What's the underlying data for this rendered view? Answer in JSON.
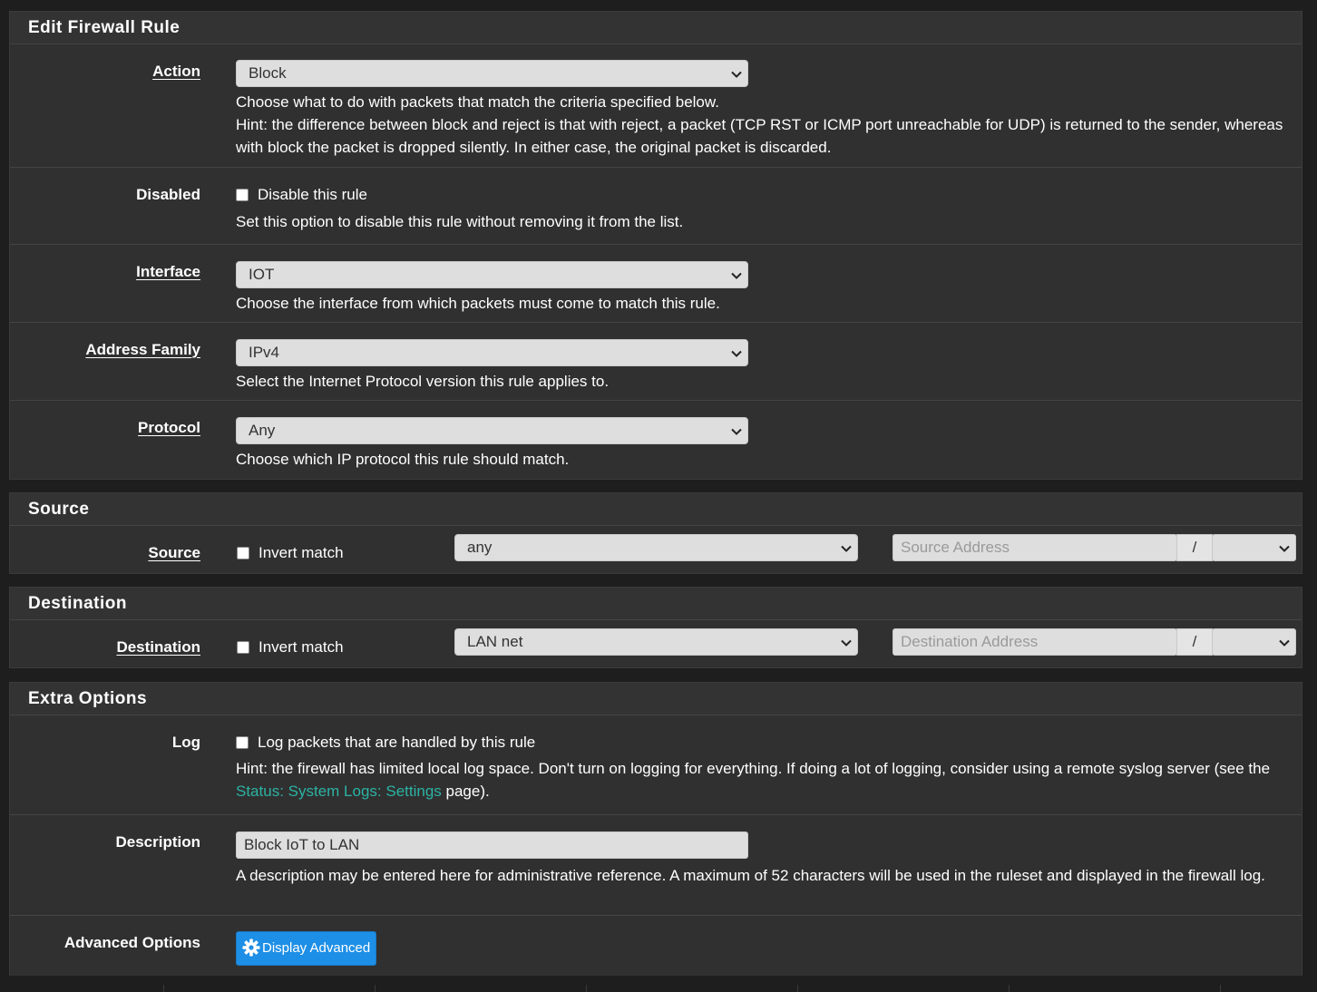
{
  "rule": {
    "heading": "Edit Firewall Rule",
    "action": {
      "label": "Action",
      "value": "Block",
      "help1": "Choose what to do with packets that match the criteria specified below.",
      "help2": "Hint: the difference between block and reject is that with reject, a packet (TCP RST or ICMP port unreachable for UDP) is returned to the sender, whereas with block the packet is dropped silently. In either case, the original packet is discarded."
    },
    "disabled": {
      "label": "Disabled",
      "checkbox_label": "Disable this rule",
      "checked": false,
      "help": "Set this option to disable this rule without removing it from the list."
    },
    "interface": {
      "label": "Interface",
      "value": "IOT",
      "help": "Choose the interface from which packets must come to match this rule."
    },
    "address_family": {
      "label": "Address Family",
      "value": "IPv4",
      "help": "Select the Internet Protocol version this rule applies to."
    },
    "protocol": {
      "label": "Protocol",
      "value": "Any",
      "help": "Choose which IP protocol this rule should match."
    }
  },
  "source": {
    "heading": "Source",
    "label": "Source",
    "invert_label": "Invert match",
    "invert_checked": false,
    "type_value": "any",
    "address_placeholder": "Source Address",
    "slash": "/"
  },
  "destination": {
    "heading": "Destination",
    "label": "Destination",
    "invert_label": "Invert match",
    "invert_checked": false,
    "type_value": "LAN net",
    "address_placeholder": "Destination Address",
    "slash": "/"
  },
  "extra": {
    "heading": "Extra Options",
    "log": {
      "label": "Log",
      "checkbox_label": "Log packets that are handled by this rule",
      "checked": false,
      "help_prefix": "Hint: the firewall has limited local log space. Don't turn on logging for everything. If doing a lot of logging, consider using a remote syslog server (see the ",
      "help_link": "Status: System Logs: Settings",
      "help_suffix": " page)."
    },
    "description": {
      "label": "Description",
      "value": "Block IoT to LAN",
      "help": "A description may be entered here for administrative reference. A maximum of 52 characters will be used in the ruleset and displayed in the firewall log."
    },
    "advanced": {
      "label": "Advanced Options",
      "button_label": "Display Advanced"
    }
  },
  "colors": {
    "accent_button": "#1e8fe6",
    "link": "#2bb3a3",
    "panel_bg": "#303030"
  }
}
